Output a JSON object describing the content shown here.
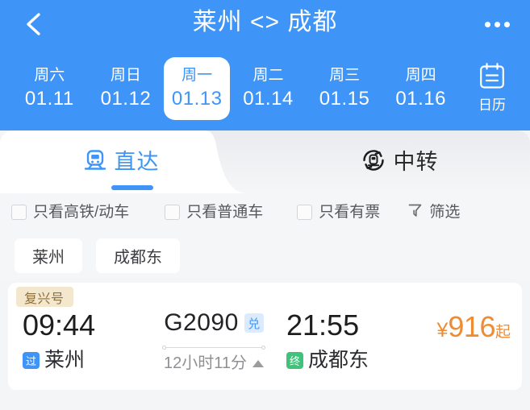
{
  "header": {
    "back_icon": "chevron-left-icon",
    "title": "莱州 <> 成都",
    "more_icon": "more-horizontal-icon"
  },
  "datebar": {
    "dates": [
      {
        "dow": "周六",
        "date": "01.11",
        "active": false
      },
      {
        "dow": "周日",
        "date": "01.12",
        "active": false
      },
      {
        "dow": "周一",
        "date": "01.13",
        "active": true
      },
      {
        "dow": "周二",
        "date": "01.14",
        "active": false
      },
      {
        "dow": "周三",
        "date": "01.15",
        "active": false
      },
      {
        "dow": "周四",
        "date": "01.16",
        "active": false
      }
    ],
    "calendar": {
      "icon": "calendar-icon",
      "label": "日历"
    }
  },
  "tabs": [
    {
      "label": "直达",
      "icon": "train-front-icon",
      "active": true
    },
    {
      "label": "中转",
      "icon": "train-transfer-icon",
      "active": false
    }
  ],
  "filters": {
    "items": [
      {
        "label": "只看高铁/动车",
        "checked": false
      },
      {
        "label": "只看普通车",
        "checked": false
      },
      {
        "label": "只看有票",
        "checked": false
      }
    ],
    "sort": {
      "label": "筛选",
      "icon": "funnel-icon"
    }
  },
  "station_chips": [
    {
      "label": "莱州"
    },
    {
      "label": "成都东"
    }
  ],
  "trains": [
    {
      "tag": "复兴号",
      "depart_time": "09:44",
      "depart_badge": "过",
      "depart_station": "莱州",
      "train_no": "G2090",
      "train_no_badge": "兑",
      "duration": "12小时11分",
      "arrive_time": "21:55",
      "arrive_badge": "终",
      "arrive_station": "成都东",
      "price_currency": "¥",
      "price_amount": "916",
      "price_suffix": "起"
    }
  ],
  "colors": {
    "brand_blue": "#3e95f7",
    "price_orange": "#ef8c33",
    "end_green": "#3fc27a",
    "tag_beige": "#f3e8cd"
  }
}
